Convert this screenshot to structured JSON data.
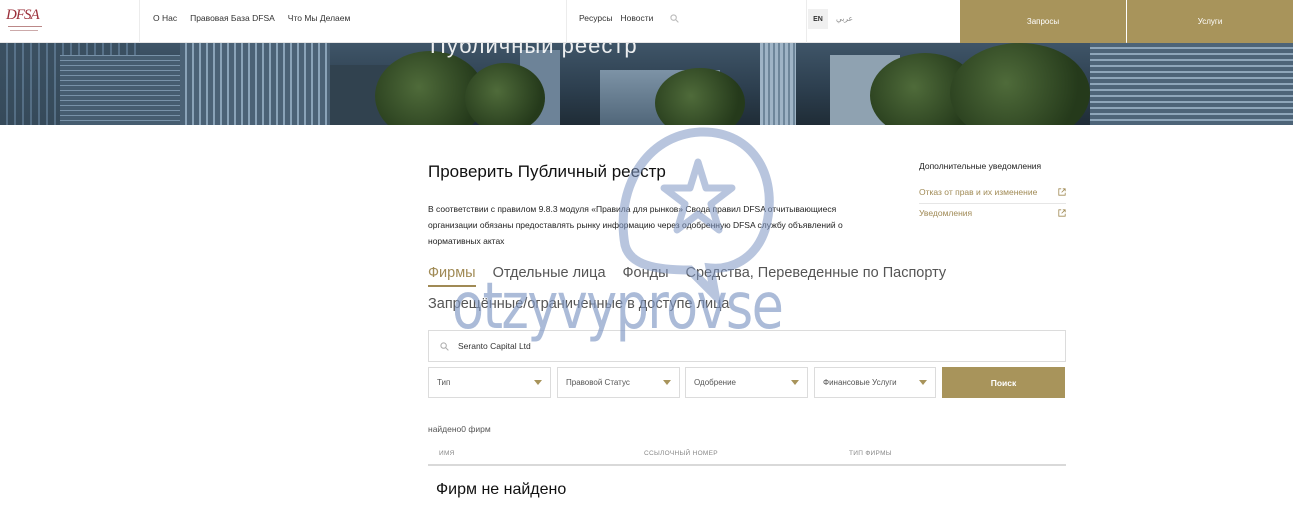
{
  "header": {
    "logo_text": "DFSA",
    "nav_left": [
      "О Нас",
      "Правовая База DFSA",
      "Что Мы Делаем"
    ],
    "nav_mid": [
      "Ресурсы",
      "Новости"
    ],
    "lang_active": "EN",
    "lang_alt": "عربي",
    "requests_label": "Запросы",
    "services_label": "Услуги"
  },
  "hero": {
    "title": "Публичный реестр"
  },
  "main": {
    "title": "Проверить Публичный реестр",
    "description": "В соответствии с правилом 9.8.3 модуля «Правила для рынков» Свода правил DFSA отчитывающиеся организации обязаны предоставлять рынку информацию через одобренную DFSA службу объявлений о нормативных актах"
  },
  "sidebar": {
    "heading": "Дополнительные уведомления",
    "links": [
      "Отказ от прав и их изменение",
      "Уведомления"
    ]
  },
  "tabs": {
    "row1": [
      "Фирмы",
      "Отдельные лица",
      "Фонды",
      "Средства, Переведенные по Паспорту"
    ],
    "row2": "Запрещённые/ограниченные в доступе лица"
  },
  "search": {
    "value": "Seranto Capital Ltd"
  },
  "filters": {
    "type": "Тип",
    "legal_status": "Правовой Статус",
    "approval": "Одобрение",
    "financial_services": "Финансовые Услуги",
    "search_button": "Поиск"
  },
  "results": {
    "found_text": "найдено0 фирм",
    "columns": [
      "имя",
      "ссылочный номер",
      "тип фирмы"
    ],
    "empty_text": "Фирм не найдено"
  },
  "watermark": {
    "text": "otzyvyprovse"
  },
  "colors": {
    "gold": "#a8945b",
    "gold_text": "#a08a55",
    "logo": "#9b2f3a"
  }
}
